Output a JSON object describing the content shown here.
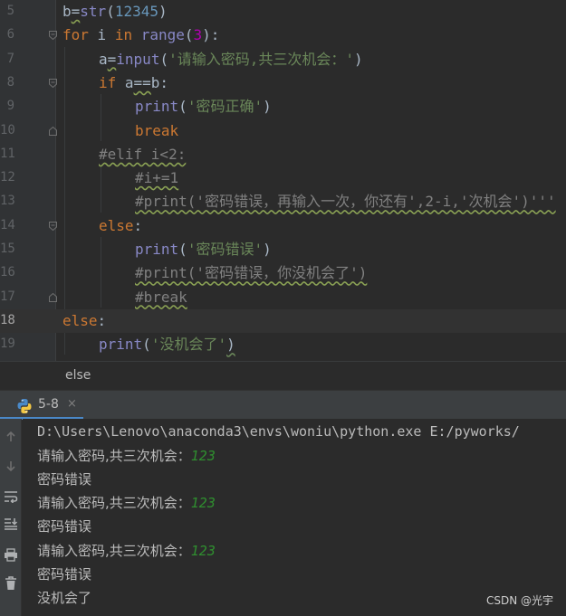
{
  "editor": {
    "line_numbers": [
      "5",
      "6",
      "7",
      "8",
      "9",
      "10",
      "11",
      "12",
      "13",
      "14",
      "15",
      "16",
      "17",
      "18",
      "19"
    ],
    "current_line": "18",
    "lines": {
      "l5": {
        "a": "b",
        "b": "=",
        "c": "str",
        "d": "(",
        "e": "12345",
        "f": ")"
      },
      "l6": {
        "a": "for",
        "b": " i ",
        "c": "in",
        "d": " ",
        "e": "range",
        "f": "(",
        "g": "3",
        "h": "):"
      },
      "l7": {
        "a": "a",
        "b": "=",
        "c": "input",
        "d": "(",
        "e": "'请输入密码,共三次机会：'",
        "f": ")"
      },
      "l8": {
        "a": "if",
        "b": " a",
        "c": "==",
        "d": "b:"
      },
      "l9": {
        "a": "print",
        "b": "(",
        "c": "'密码正确'",
        "d": ")"
      },
      "l10": {
        "a": "break"
      },
      "l11": {
        "a": "#elif i<2:"
      },
      "l12": {
        "a": "#i+=1"
      },
      "l13": {
        "a": "#print('密码错误，再输入一次，你还有',2-i,'次机会')'''"
      },
      "l14": {
        "a": "else",
        "b": ":"
      },
      "l15": {
        "a": "print",
        "b": "(",
        "c": "'密码错误'",
        "d": ")"
      },
      "l16": {
        "a": "#print('密码错误，你没机会了')"
      },
      "l17": {
        "a": "#break"
      },
      "l18": {
        "a": "else",
        "b": ":"
      },
      "l19": {
        "a": "print",
        "b": "(",
        "c": "'没机会了'",
        "d": ")"
      }
    }
  },
  "breadcrumb": {
    "text": "else"
  },
  "run": {
    "tab_label": "5-8",
    "tab_close": "×",
    "console": [
      {
        "text": "D:\\Users\\Lenovo\\anaconda3\\envs\\woniu\\python.exe E:/pyworks/"
      },
      {
        "text": "请输入密码,共三次机会：",
        "input": "123"
      },
      {
        "text": "密码错误"
      },
      {
        "text": "请输入密码,共三次机会：",
        "input": "123"
      },
      {
        "text": "密码错误"
      },
      {
        "text": "请输入密码,共三次机会：",
        "input": "123"
      },
      {
        "text": "密码错误"
      },
      {
        "text": "没机会了"
      }
    ],
    "toolbar_icons": [
      "arrow-up-icon",
      "arrow-down-icon",
      "soft-wrap-icon",
      "scroll-to-end-icon",
      "print-icon",
      "trash-icon"
    ]
  },
  "watermark": "CSDN @光宇",
  "colors": {
    "editor_bg": "#2b2b2b",
    "keyword": "#cc7832",
    "string": "#6a8759",
    "number": "#6897bb",
    "builtin": "#8888c6",
    "comment": "#808080",
    "user_input": "#2f8f2f",
    "tab_underline": "#4a88c7"
  }
}
